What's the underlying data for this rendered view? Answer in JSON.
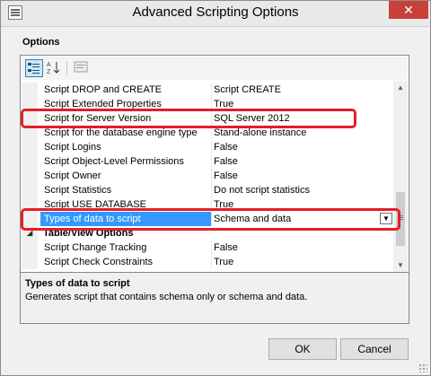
{
  "window": {
    "title": "Advanced Scripting Options",
    "close_glyph": "✕"
  },
  "options_label": "Options",
  "toolbar": {
    "categorized_icon": "categorized-view-icon",
    "alphabetical_icon": "sort-alphabetical-icon",
    "property_pages_icon": "property-pages-icon"
  },
  "properties": [
    {
      "name": "Script DROP and CREATE",
      "value": "Script CREATE"
    },
    {
      "name": "Script Extended Properties",
      "value": "True"
    },
    {
      "name": "Script for Server Version",
      "value": "SQL Server 2012"
    },
    {
      "name": "Script for the database engine type",
      "value": "Stand-alone instance"
    },
    {
      "name": "Script Logins",
      "value": "False"
    },
    {
      "name": "Script Object-Level Permissions",
      "value": "False"
    },
    {
      "name": "Script Owner",
      "value": "False"
    },
    {
      "name": "Script Statistics",
      "value": "Do not script statistics"
    },
    {
      "name": "Script USE DATABASE",
      "value": "True"
    },
    {
      "name": "Types of data to script",
      "value": "Schema and data",
      "selected": true
    },
    {
      "name": "Table/View Options",
      "value": "",
      "category": true
    },
    {
      "name": "Script Change Tracking",
      "value": "False"
    },
    {
      "name": "Script Check Constraints",
      "value": "True"
    }
  ],
  "description": {
    "title": "Types of data to script",
    "text": "Generates script that contains schema only or schema and data."
  },
  "buttons": {
    "ok": "OK",
    "cancel": "Cancel"
  },
  "colors": {
    "selection": "#3399ff",
    "highlight_annotation": "#e41e26",
    "close_button": "#c7403a"
  }
}
